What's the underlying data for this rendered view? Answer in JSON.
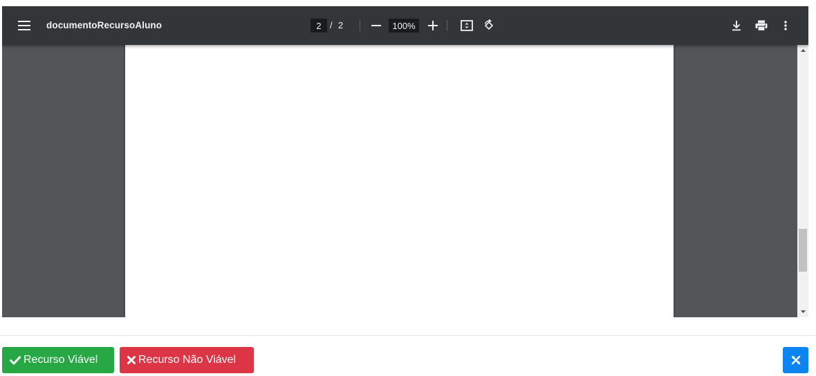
{
  "viewer": {
    "title": "documentoRecursoAluno",
    "page_current": "2",
    "page_separator": "/",
    "page_total": "2",
    "zoom_level": "100%",
    "icons": {
      "menu": "menu-icon",
      "zoom_out": "minus-icon",
      "zoom_in": "plus-icon",
      "fit": "fit-to-page-icon",
      "rotate": "rotate-icon",
      "download": "download-icon",
      "print": "print-icon",
      "more": "more-vertical-icon"
    }
  },
  "footer": {
    "approve_label": "Recurso Viável",
    "reject_label": "Recurso Não Viável",
    "colors": {
      "approve": "#28a745",
      "reject": "#dc3545",
      "primary": "#0d84f0"
    }
  }
}
